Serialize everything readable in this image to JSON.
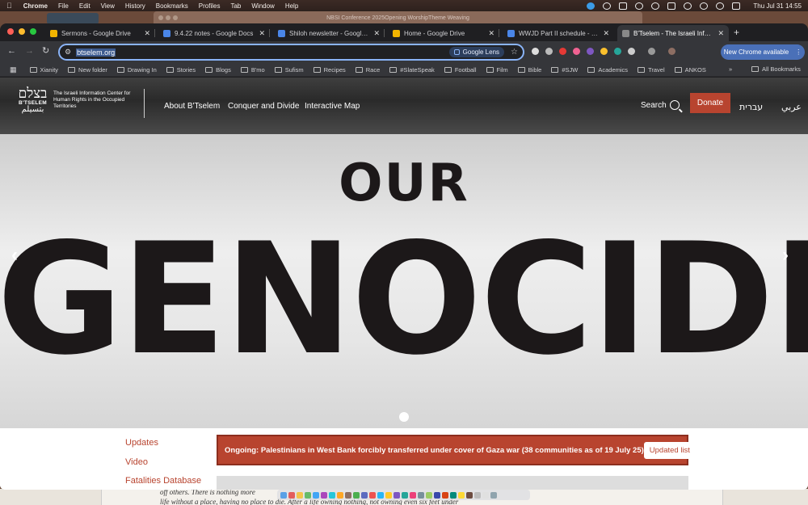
{
  "menubar": {
    "app": "Chrome",
    "items": [
      "File",
      "Edit",
      "View",
      "History",
      "Bookmarks",
      "Profiles",
      "Tab",
      "Window",
      "Help"
    ],
    "clock": "Thu Jul 31  14:55"
  },
  "background_window": {
    "title": "NBSI Conference 2025Opening WorshipTheme Weaving",
    "doc_line1": "off others. There is nothing more",
    "doc_line2": "life without a place, having no place to die. After a life owning nothing, not owning even six feet under"
  },
  "tabs": [
    {
      "label": "Sermons - Google Drive",
      "icon": "drive-icon",
      "color": "#f2b400"
    },
    {
      "label": "9.4.22 notes - Google Docs",
      "icon": "docs-icon",
      "color": "#4a86e8"
    },
    {
      "label": "Shiloh newsletter - Google Do",
      "icon": "docs-icon",
      "color": "#4a86e8"
    },
    {
      "label": "Home - Google Drive",
      "icon": "drive-icon",
      "color": "#f2b400"
    },
    {
      "label": "WWJD Part II schedule - Goo",
      "icon": "docs-icon",
      "color": "#4a86e8"
    },
    {
      "label": "B'Tselem - The Israeli Informa",
      "icon": "site-icon",
      "color": "#888888",
      "active": true
    }
  ],
  "toolbar": {
    "url": "btselem.org",
    "lens_label": "Google Lens",
    "new_chrome": "New Chrome available"
  },
  "bookmarks": {
    "items": [
      "Xianity",
      "New folder",
      "Drawing In",
      "Stories",
      "Blogs",
      "B'mo",
      "Sufism",
      "Recipes",
      "Race",
      "#SlateSpeak",
      "Football",
      "Film",
      "Bible",
      "#SJW",
      "Academics",
      "Travel",
      "ANKOS"
    ],
    "more": "»",
    "all": "All Bookmarks"
  },
  "site": {
    "logo_hebrew": "בצלם",
    "logo_latin": "B'TSELEM",
    "logo_arabic": "بتسيلم",
    "tagline": "The Israeli Information Center for Human Rights in the Occupied Territories",
    "nav": [
      "About B'Tselem",
      "Conquer and Divide",
      "Interactive Map"
    ],
    "search": "Search",
    "donate": "Donate",
    "lang_hebrew": "עברית",
    "lang_arabic": "عربي",
    "brand_color": "#b8442f"
  },
  "hero": {
    "line1": "OUR",
    "line2": "GENOCIDE",
    "prev": "‹",
    "next": "›"
  },
  "lower": {
    "links": [
      "Updates",
      "Video",
      "Fatalities Database"
    ],
    "banner_text": "Ongoing: Palestinians in West Bank forcibly transferred under cover of Gaza war (38 communities as of 19 July 25)",
    "banner_button": "Updated list"
  }
}
